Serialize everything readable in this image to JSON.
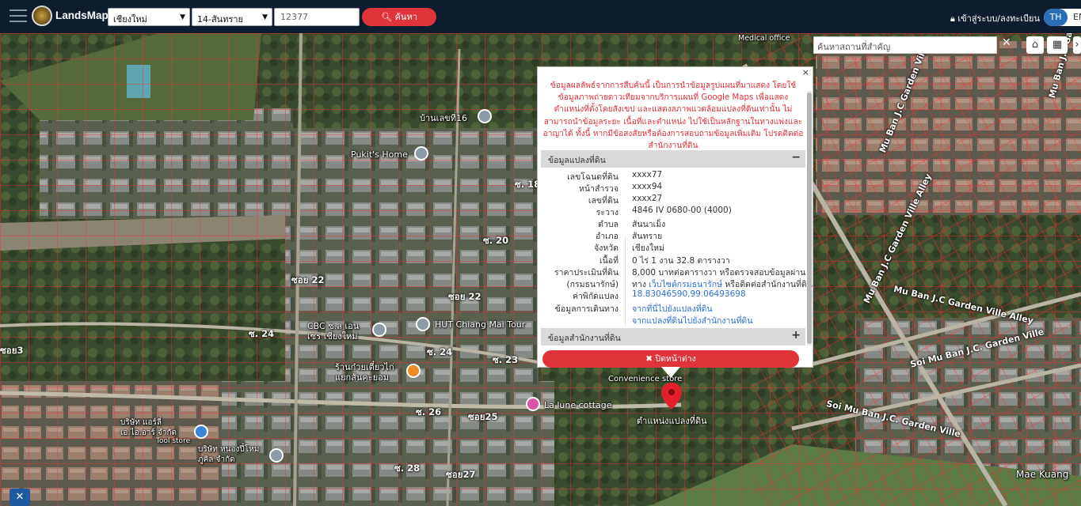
{
  "header": {
    "brand": "LandsMaps",
    "province": "เชียงใหม่",
    "district": "14-สันทราย",
    "parcel_value": "12377",
    "search_label": "ค้นหา",
    "login_label": "เข้าสู่ระบบ/ลงทะเบียน",
    "lang_th": "TH",
    "lang_en": "EN"
  },
  "map": {
    "place_search_placeholder": "ค้นหาสถานที่สำคัญ",
    "labels": {
      "ban_lek_16": "บ้านเลขที่16",
      "pukits_home": "Pukit's Home",
      "soi_18": "ซ. 18",
      "soi_20": "ซ. 20",
      "soi_22a": "ซอย 22",
      "soi_22b": "ซอย 22",
      "soi_24a": "ซ. 24",
      "soi_24b": "ซ. 24",
      "soi_23": "ซ. 23",
      "soi_26": "ซ. 26",
      "soi_25": "ซอย25",
      "soi_28": "ซ. 28",
      "soi_27": "ซอย27",
      "soi_3": "ซอย3",
      "cbc": "CBC ซ.ล เอน\nเซร เชียงใหม่",
      "hut": "HUT Chiang Mai Tour",
      "noodle": "ร้านก๋วยเตี๋ยวไก่\nแยกสันคะยอม",
      "convenience": "Convenience store",
      "la_lune": "La lune cottage",
      "parcel_location": "ตำแหน่งแปลงที่ดิน",
      "company1": "บริษัท แอร์ลี่\nเอ.ไอ.อาร์ จำกัด",
      "tool_store": "Tool store",
      "company2": "บริษัท หนองปึ๋โหม\nภูคิล จำกัด",
      "medical": "Medical office",
      "mu_ban_a": "Mu Ban J.C Garden Ville",
      "mu_ban_b": "Mu Ban J.C Garden Ville Alley",
      "mu_ban_c": "Mu Ban J.C Garden Ville Alley",
      "mu_ban_d": "Soi Mu Ban J.C. Garden Ville",
      "mu_ban_e": "Soi Mu Ban J.C. Garden Ville",
      "mu_ban_f": "Mu Ban J.C Garden Ville",
      "mae_kuang": "Mae Kuang"
    }
  },
  "popup": {
    "close_x": "×",
    "disclaimer": "ข้อมูลผลลัพธ์จากการสืบค้นนี้ เป็นการนำข้อมูลรูปแผนที่มาแสดง โดยใช้ข้อมูลภาพถ่ายดาวเทียมจากบริการแผนที่ Google Maps เพื่อแสดงตำแหน่งที่ตั้งโดยสังเขป และแสดงสภาพแวดล้อมแปลงที่ดินเท่านั้น ไม่สามารถนำข้อมูลระยะ เนื้อที่และตำแหน่ง ไปใช้เป็นหลักฐานในทางแพ่งและอาญาได้ ทั้งนี้ หากมีข้อสงสัยหรือต้องการสอบถามข้อมูลเพิ่มเติม โปรดติดต่อสำนักงานที่ดิน",
    "section1_title": "ข้อมูลแปลงที่ดิน",
    "section1_toggle": "−",
    "section2_title": "ข้อมูลสำนักงานที่ดิน",
    "section2_toggle": "+",
    "rows": [
      {
        "k": "เลขโฉนดที่ดิน",
        "v": "xxxx77"
      },
      {
        "k": "หน้าสำรวจ",
        "v": "xxxx94"
      },
      {
        "k": "เลขที่ดิน",
        "v": "xxxx27"
      },
      {
        "k": "ระวาง",
        "v": "4846 IV 0680-00 (4000)"
      },
      {
        "k": "ตำบล",
        "v": "สันนาเม็ง"
      },
      {
        "k": "อำเภอ",
        "v": "สันทราย"
      },
      {
        "k": "จังหวัด",
        "v": "เชียงใหม่"
      },
      {
        "k": "เนื้อที่",
        "v": "0 ไร่ 1 งาน 32.8 ตารางวา"
      },
      {
        "k": "ราคาประเมินที่ดิน",
        "v": "8,000 บาทต่อตารางวา หรือตรวจสอบข้อมูลผ่าน"
      },
      {
        "k": "(กรมธนารักษ์)",
        "v_prefix": "ทาง ",
        "v_link": "เว็บไซต์กรมธนารักษ์",
        "v_suffix": " หรือติดต่อสำนักงานที่ดิน"
      },
      {
        "k": "ค่าพิกัดแปลง",
        "v_link": "18.83046590,99.06493698"
      },
      {
        "k": "ข้อมูลการเดินทาง",
        "v_link": "จากที่นี่ไปยังแปลงที่ดิน"
      },
      {
        "k": "",
        "v_link": "จากแปลงที่ดินไปยังสำนักงานที่ดิน"
      }
    ],
    "close_window_label": "✖ ปิดหน้าต่าง"
  }
}
